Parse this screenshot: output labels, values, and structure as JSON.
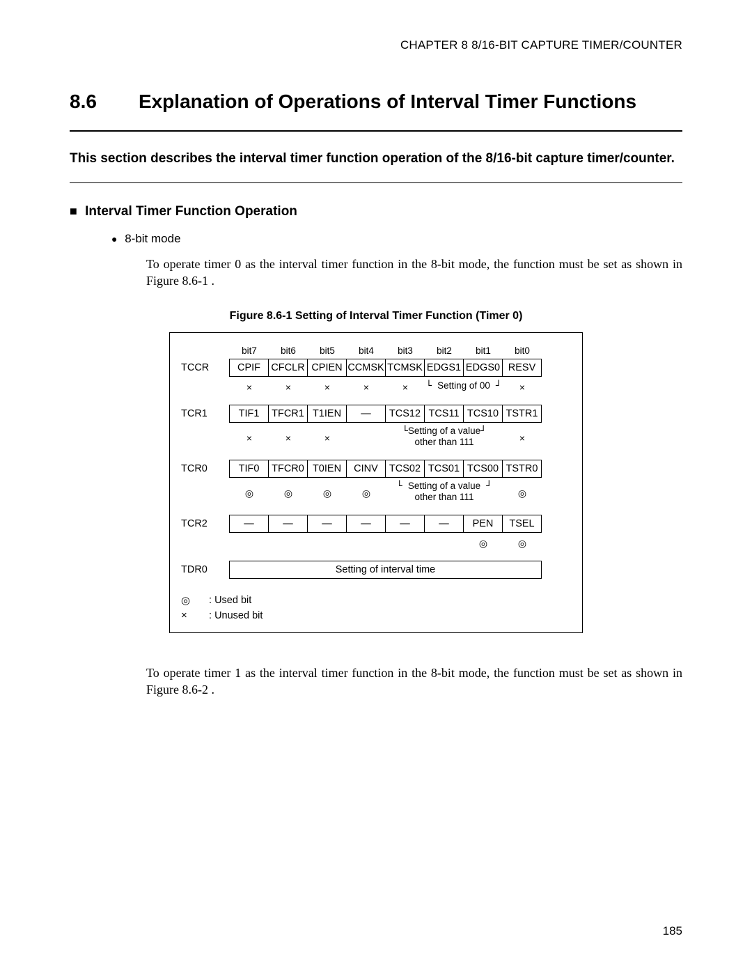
{
  "chapter_header": "CHAPTER 8  8/16-BIT CAPTURE TIMER/COUNTER",
  "section": {
    "num": "8.6",
    "title": "Explanation of Operations of Interval Timer Functions"
  },
  "intro": "This section describes the interval timer function operation of the 8/16-bit capture timer/counter.",
  "subhead": "Interval Timer Function Operation",
  "bullet_8bit": "8-bit mode",
  "para1": "To operate timer 0 as the interval timer function in the 8-bit mode, the function must be set as shown in Figure 8.6-1 .",
  "figcaption": "Figure 8.6-1  Setting of Interval Timer Function (Timer 0)",
  "chart_data": {
    "type": "table",
    "title": "Setting of Interval Timer Function (Timer 0)",
    "bit_headers": [
      "bit7",
      "bit6",
      "bit5",
      "bit4",
      "bit3",
      "bit2",
      "bit1",
      "bit0"
    ],
    "symbols": {
      "used": "◎",
      "unused": "×",
      "dash": "—"
    },
    "used_symbol": "◎",
    "unused_symbol": "×",
    "dash_symbol": "—",
    "legend": {
      "used": "Used bit",
      "unused": "Unused bit"
    },
    "registers": [
      {
        "name": "TCCR",
        "bits": [
          "CPIF",
          "CFCLR",
          "CPIEN",
          "CCMSK",
          "TCMSK",
          "EDGS1",
          "EDGS0",
          "RESV"
        ],
        "state": [
          "×",
          "×",
          "×",
          "×",
          "×",
          "note00",
          "note00",
          "×"
        ],
        "note": "Setting of 00"
      },
      {
        "name": "TCR1",
        "bits": [
          "TIF1",
          "TFCR1",
          "T1IEN",
          "—",
          "TCS12",
          "TCS11",
          "TCS10",
          "TSTR1"
        ],
        "state": [
          "×",
          "×",
          "×",
          "",
          "note111",
          "note111",
          "note111",
          "×"
        ],
        "note": "Setting of a value other than 111"
      },
      {
        "name": "TCR0",
        "bits": [
          "TIF0",
          "TFCR0",
          "T0IEN",
          "CINV",
          "TCS02",
          "TCS01",
          "TCS00",
          "TSTR0"
        ],
        "state": [
          "◎",
          "◎",
          "◎",
          "◎",
          "note111",
          "note111",
          "note111",
          "◎"
        ],
        "note": "Setting of a value other than 111"
      },
      {
        "name": "TCR2",
        "bits": [
          "—",
          "—",
          "—",
          "—",
          "—",
          "—",
          "PEN",
          "TSEL"
        ],
        "state": [
          "",
          "",
          "",
          "",
          "",
          "",
          "◎",
          "◎"
        ]
      },
      {
        "name": "TDR0",
        "bits": [],
        "wide": "Setting of interval time"
      }
    ]
  },
  "para2": "To operate timer 1 as the interval timer function in the 8-bit mode, the function must be set as shown in Figure 8.6-2 .",
  "pagenum": "185"
}
